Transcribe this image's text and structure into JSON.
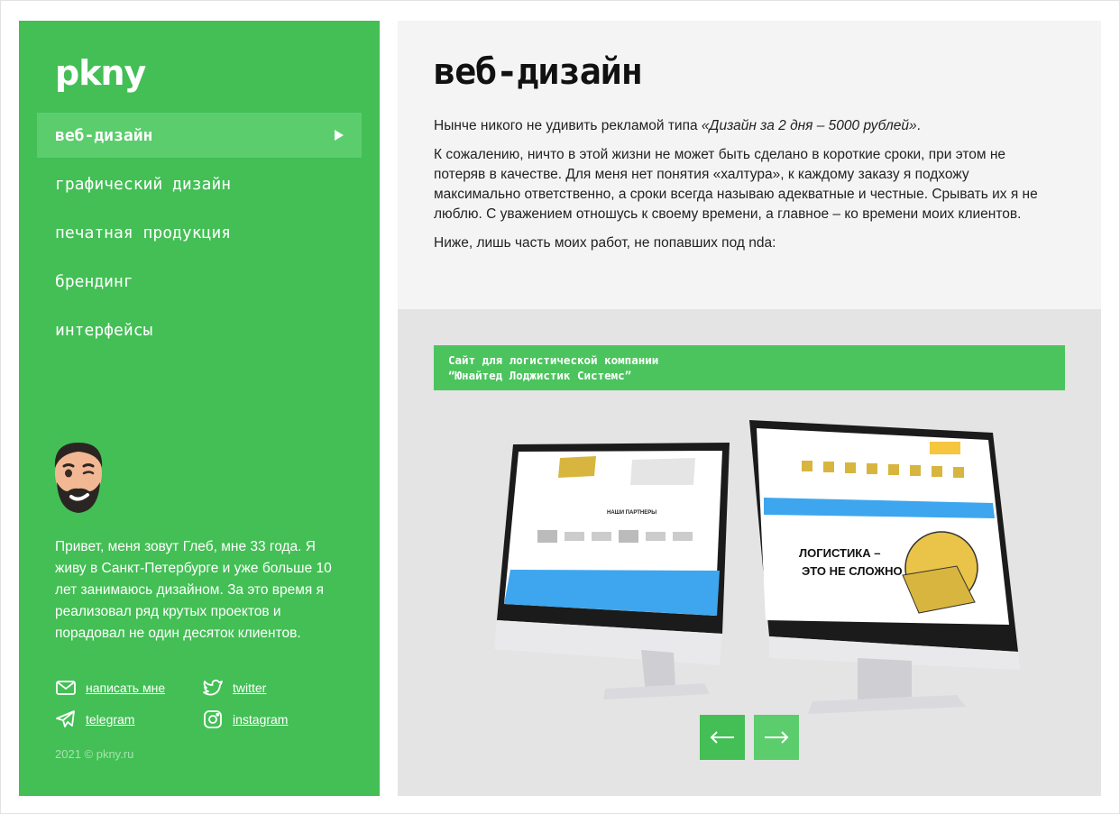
{
  "sidebar": {
    "logo": "pkny",
    "nav": [
      {
        "label": "веб-дизайн",
        "active": true
      },
      {
        "label": "графический дизайн",
        "active": false
      },
      {
        "label": "печатная продукция",
        "active": false
      },
      {
        "label": "брендинг",
        "active": false
      },
      {
        "label": "интерфейсы",
        "active": false
      }
    ],
    "about": "Привет, меня зовут Глеб, мне 33 года. Я живу в Санкт-Петербурге и уже больше 10 лет занимаюсь дизайном. За это время я реализовал ряд крутых проектов и порадовал не один десяток клиентов.",
    "contacts": {
      "email": {
        "label": "написать мне",
        "icon": "mail-icon"
      },
      "twitter": {
        "label": "twitter",
        "icon": "twitter-icon"
      },
      "telegram": {
        "label": "telegram",
        "icon": "telegram-icon"
      },
      "instagram": {
        "label": "instagram",
        "icon": "instagram-icon"
      }
    },
    "copyright": "2021 © pkny.ru"
  },
  "main": {
    "title": "веб-дизайн",
    "intro_1_plain": "Нынче никого не удивить рекламой типа ",
    "intro_1_italic": "«Дизайн за 2 дня – 5000 рублей»",
    "intro_1_end": ".",
    "intro_2": "К сожалению, ничто в этой жизни не может быть сделано в короткие сроки, при этом не потеряв в качестве. Для меня нет понятия «халтура», к каждому заказу я подхожу максимально ответственно, а сроки всегда называю адекватные и честные. Срывать их я не люблю. С уважением отношусь к своему времени, а главное – ко времени моих клиентов.",
    "intro_3": "Ниже, лишь часть моих работ, не попавших под nda:",
    "project": {
      "line_1": "Сайт для логистической компании",
      "line_2": "“Юнайтед Лоджистик Системс”",
      "screen_partners": "НАШИ ПАРТНЕРЫ",
      "screen_headline_1": "ЛОГИСТИКА –",
      "screen_headline_2": "ЭТО НЕ СЛОЖНО"
    }
  },
  "colors": {
    "accent": "#43bf55",
    "accent_light": "#5ccd6c"
  }
}
